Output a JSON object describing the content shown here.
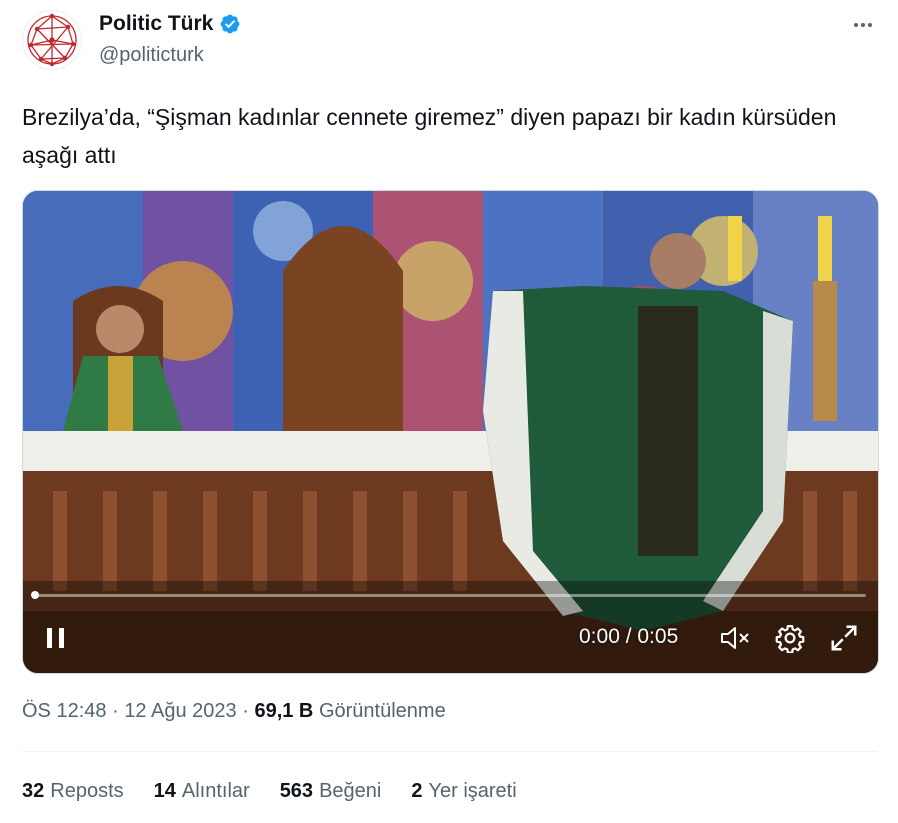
{
  "author": {
    "display_name": "Politic Türk",
    "handle": "@politicturk",
    "verified": true,
    "verified_color": "#1d9bf0",
    "avatar_color": "#c1272d"
  },
  "tweet": {
    "text": "Brezilya’da, “Şişman kadınlar cennete giremez” diyen papazı bir kadın kürsüden aşağı attı"
  },
  "video": {
    "time": "0:00 / 0:05",
    "progress": 0.0,
    "state": "playing",
    "icons": [
      "pause-icon",
      "mute-icon",
      "settings-icon",
      "fullscreen-icon"
    ]
  },
  "meta": {
    "time": "ÖS 12:48",
    "separator": "·",
    "date": "12 Ağu 2023",
    "views_count": "69,1 B",
    "views_label": "Görüntülenme"
  },
  "stats": [
    {
      "count": "32",
      "label": "Reposts"
    },
    {
      "count": "14",
      "label": "Alıntılar"
    },
    {
      "count": "563",
      "label": "Beğeni"
    },
    {
      "count": "2",
      "label": "Yer işareti"
    }
  ]
}
